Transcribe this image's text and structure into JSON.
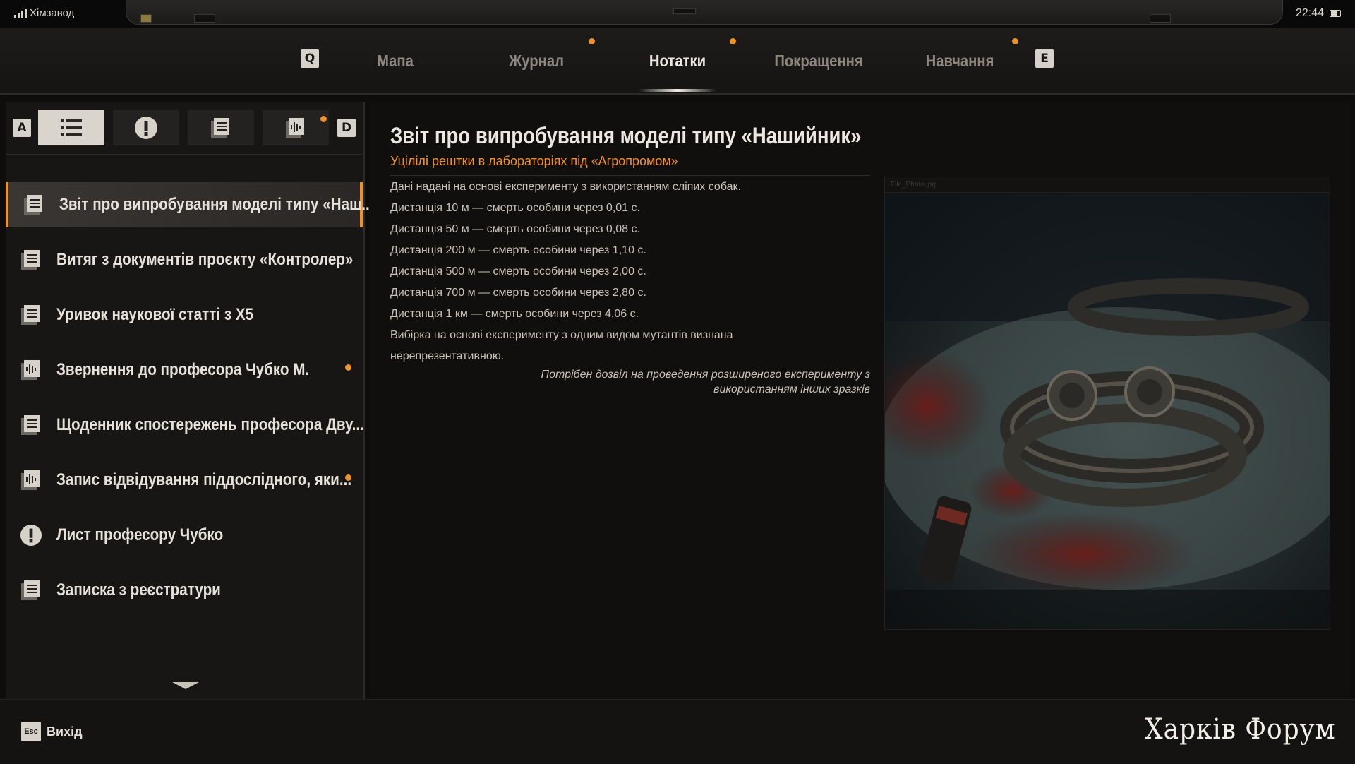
{
  "status": {
    "carrier": "Хімзавод",
    "time": "22:44"
  },
  "tabs": {
    "prev_key": "Q",
    "next_key": "E",
    "items": [
      {
        "label": "Мапа",
        "active": false,
        "new": false
      },
      {
        "label": "Журнал",
        "active": false,
        "new": true
      },
      {
        "label": "Нотатки",
        "active": true,
        "new": true
      },
      {
        "label": "Покращення",
        "active": false,
        "new": false
      },
      {
        "label": "Навчання",
        "active": false,
        "new": true
      }
    ]
  },
  "filters": {
    "prev_key": "A",
    "next_key": "D",
    "items": [
      {
        "icon": "list-icon",
        "active": true
      },
      {
        "icon": "exclamation-icon",
        "active": false
      },
      {
        "icon": "document-icon",
        "active": false
      },
      {
        "icon": "audio-icon",
        "active": false,
        "new": true
      }
    ]
  },
  "notes": [
    {
      "title": "Звіт про випробування моделі типу «Наш...",
      "icon": "document-icon",
      "selected": true,
      "new": false
    },
    {
      "title": "Витяг з документів проєкту «Контролер»",
      "icon": "document-icon",
      "selected": false,
      "new": false
    },
    {
      "title": "Уривок наукової статті з Х5",
      "icon": "document-icon",
      "selected": false,
      "new": false
    },
    {
      "title": "Звернення до професора Чубко М.",
      "icon": "audio-icon",
      "selected": false,
      "new": true
    },
    {
      "title": "Щоденник спостережень професора Дву...",
      "icon": "document-icon",
      "selected": false,
      "new": false
    },
    {
      "title": "Запис відвідування піддослідного, яки...",
      "icon": "audio-icon",
      "selected": false,
      "new": true
    },
    {
      "title": "Лист професору Чубко",
      "icon": "exclamation-icon",
      "selected": false,
      "new": false
    },
    {
      "title": "Записка з реєстратури",
      "icon": "document-icon",
      "selected": false,
      "new": false
    }
  ],
  "document": {
    "title": "Звіт про випробування моделі типу «Нашийник»",
    "subtitle": "Уцілілі рештки в лабораторіях під «Агропромом»",
    "lines": [
      " Дані надані на основі експерименту з використанням сліпих собак.",
      "Дистанція 10 м — смерть особини через 0,01 с.",
      "Дистанція 50 м — смерть особини через 0,08 с.",
      "Дистанція 200 м — смерть особини через 1,10 с.",
      "Дистанція 500 м — смерть особини через 2,00 с.",
      "Дистанція 700 м — смерть особини через 2,80 с.",
      "Дистанція 1 км — смерть особини через 4,06 с.",
      "Вибірка на основі експерименту з одним видом мутантів визнана",
      "нерепрезентативною."
    ],
    "note_line1": "Потрібен дозвіл на проведення розширеного експерименту з",
    "note_line2": "використанням інших зразків",
    "photo_caption": "File_Photo.jpg"
  },
  "footer": {
    "esc_key": "Esc",
    "exit_label": "Вихід",
    "watermark": "Харків Форум"
  },
  "colors": {
    "accent": "#f0922c",
    "text": "#e6e1d9",
    "panel": "#181615"
  }
}
